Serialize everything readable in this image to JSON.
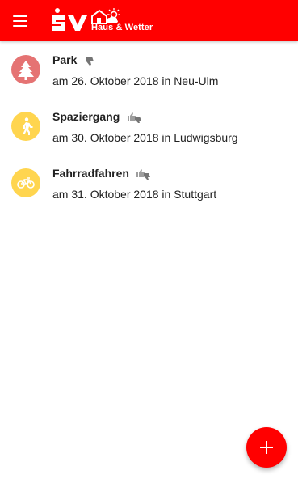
{
  "header": {
    "brand_logo_text": "SV",
    "brand_subtitle": "Haus & Wetter"
  },
  "activities": [
    {
      "title": "Park",
      "subtitle": "am 26. Oktober 2018 in Neu-Ulm",
      "icon": "tree-icon",
      "color": "#e57373",
      "rating": "thumbs-down"
    },
    {
      "title": "Spaziergang",
      "subtitle": "am 30. Oktober 2018 in Ludwigsburg",
      "icon": "walking-icon",
      "color": "#ffd54f",
      "rating": "thumbs-up-down"
    },
    {
      "title": "Fahrradfahren",
      "subtitle": "am 31. Oktober 2018 in Stuttgart",
      "icon": "bicycle-icon",
      "color": "#ffd54f",
      "rating": "thumbs-up-down"
    }
  ],
  "fab": {
    "icon": "plus-icon"
  },
  "colors": {
    "brand": "#ff0000",
    "text": "#212121",
    "rating_icon": "#757575"
  }
}
